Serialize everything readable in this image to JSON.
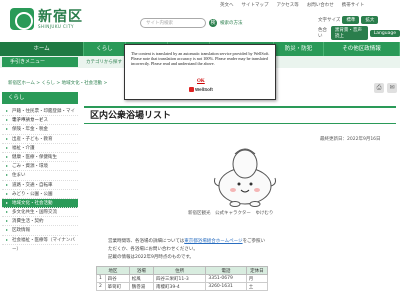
{
  "header": {
    "logo_ja": "新宿区",
    "logo_en": "SHINJUKU CITY",
    "top_links": [
      "英文へ",
      "サイトマップ",
      "アクセス等",
      "お問い合わせ",
      "携帯サイト"
    ],
    "search_placeholder": "サイト内検索",
    "search_button": "検",
    "detail_search": "検索の方法",
    "font_size_label": "文字サイズ",
    "font_standard": "標準",
    "font_large": "拡大",
    "lang_label": "色合い",
    "lang_option1": "黒背景・音声読上",
    "language_button": "Language"
  },
  "nav": {
    "items": [
      {
        "label": "ホーム",
        "active": true
      },
      {
        "label": "くらし",
        "active": false
      },
      {
        "label": "",
        "active": false
      },
      {
        "label": "",
        "active": false
      },
      {
        "label": "",
        "active": false
      },
      {
        "label": "防災・防犯",
        "active": false
      },
      {
        "label": "その他区政情報",
        "active": false
      }
    ]
  },
  "utility": {
    "left_label": "手引きメニュー",
    "link": "カテゴリから探す"
  },
  "breadcrumb": "新宿区ホーム > くらし > 地域文化・社会活動 >",
  "sidebar": {
    "heading": "くらし",
    "items": [
      {
        "label": "戸籍・住民票・印鑑登録・マイナンバーカード",
        "active": false
      },
      {
        "label": "電子申請サービス",
        "active": false
      },
      {
        "label": "保険・年金・税金",
        "active": false
      },
      {
        "label": "出産・子ども・教育",
        "active": false
      },
      {
        "label": "福祉・介護",
        "active": false
      },
      {
        "label": "健康・医療・保健衛生",
        "active": false
      },
      {
        "label": "ごみ・資源・環境",
        "active": false
      },
      {
        "label": "住まい",
        "active": false
      },
      {
        "label": "道路・交通・自転車",
        "active": false
      },
      {
        "label": "みどり・公園・公園",
        "active": false
      },
      {
        "label": "地域文化・社会活動",
        "active": true
      },
      {
        "label": "多文化共生・国際交流",
        "active": false
      },
      {
        "label": "消費生活・契約",
        "active": false
      },
      {
        "label": "区政情報",
        "active": false
      },
      {
        "label": "社会福祉・医療等（マイナンバー）",
        "active": false
      }
    ]
  },
  "main": {
    "title": "区内公衆浴場リスト",
    "updated": "最終更新日：2022年9月16日",
    "caption": "新宿区観光　公式キャラクター　ゆけむり",
    "notice_prefix": "営業時間等、各浴場の詳細については",
    "notice_link": "東京都浴場組合ホームページ",
    "notice_suffix": "をご参照いただくか、各浴場にお問い合わせください。",
    "note2": "記載の情報は2022年9月時点のものです。",
    "table_headers": [
      "地区",
      "浴場",
      "住所",
      "電話",
      "定休日"
    ],
    "table_rows": [
      [
        "1",
        "四谷",
        "松風",
        "四谷三栄町11-3",
        "3351-0679",
        "月"
      ],
      [
        "2",
        "箪笥町",
        "鶴巻湯",
        "南榎町39-4",
        "3260-1631",
        "土"
      ]
    ]
  },
  "modal": {
    "text": "The content is translated by an automatic translation service provided by WellSoft. Please note that translation accuracy is not 100%. Please reader may be translated incorrectly. Please read and understand the above.",
    "ok": "OK",
    "brand": "WellSoft"
  }
}
